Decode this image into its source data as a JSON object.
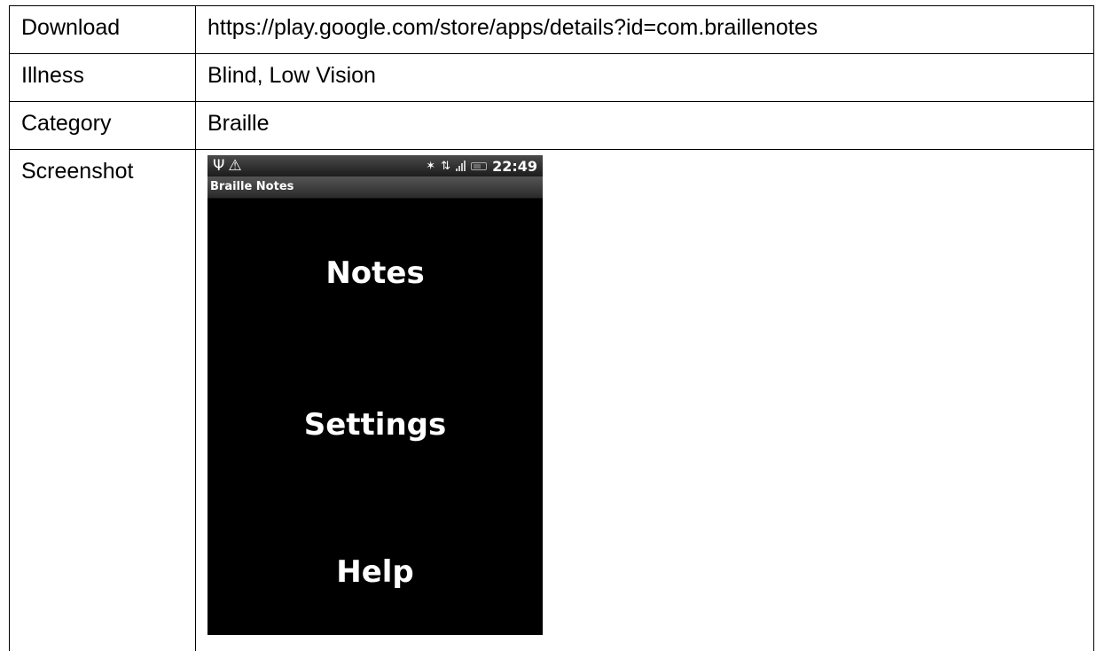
{
  "table": {
    "rows": [
      {
        "label": "Download",
        "value": "https://play.google.com/store/apps/details?id=com.braillenotes"
      },
      {
        "label": "Illness",
        "value": "Blind, Low Vision"
      },
      {
        "label": "Category",
        "value": "Braille"
      },
      {
        "label": "Screenshot"
      }
    ]
  },
  "phone": {
    "statusbar": {
      "left_icons": [
        "usb-icon",
        "warning-icon"
      ],
      "right_icons": [
        "bluetooth-icon",
        "network-icon",
        "signal-icon",
        "battery-icon"
      ],
      "time": "22:49"
    },
    "app_title": "Braille Notes",
    "menu": [
      "Notes",
      "Settings",
      "Help"
    ]
  }
}
